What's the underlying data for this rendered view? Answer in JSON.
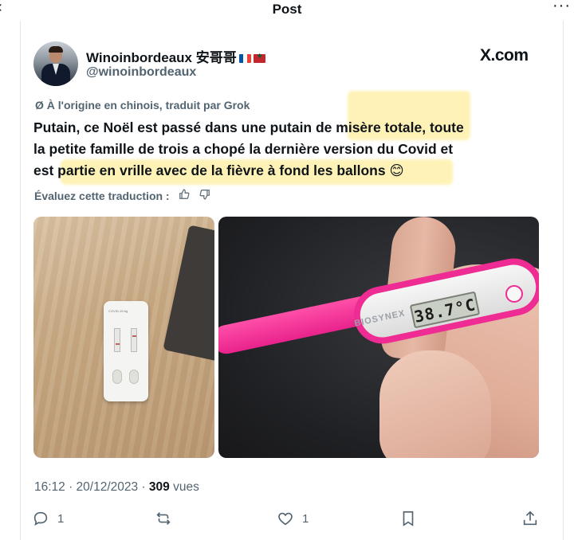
{
  "header": {
    "title": "Post",
    "back_icon": "back-arrow-icon",
    "more_icon": "more-icon"
  },
  "author": {
    "name": "Winoinbordeaux 安哥哥",
    "handle": "@winoinbordeaux",
    "source_logo": "X.com",
    "flags": [
      "flag-france-icon",
      "flag-morocco-icon"
    ]
  },
  "tweet": {
    "translation_note": "Ø À l'origine en chinois, traduit par Grok",
    "text_lines": [
      "Putain, ce Noël est passé dans une putain de misère totale, toute",
      "la petite famille de trois a chopé la dernière version du Covid et",
      "est partie en vrille avec de la fièvre à fond les ballons 😊"
    ],
    "rate_label": "Évaluez cette traduction :",
    "images": [
      {
        "alt": "covid-test-photo",
        "test_label": "COVID-19 Ag"
      },
      {
        "alt": "thermometer-photo",
        "brand": "BIOSYNEX",
        "reading": "38.7°C"
      }
    ],
    "timestamp": "16:12 · 20/12/2023 · ",
    "views_count": "309",
    "views_label": " vues"
  },
  "actions": {
    "reply_count": "1",
    "retweet_count": "",
    "like_count": "1"
  },
  "colors": {
    "highlight": "#fff2b3",
    "secondary_text": "#536471",
    "thermometer_pink": "#ef2c94"
  }
}
